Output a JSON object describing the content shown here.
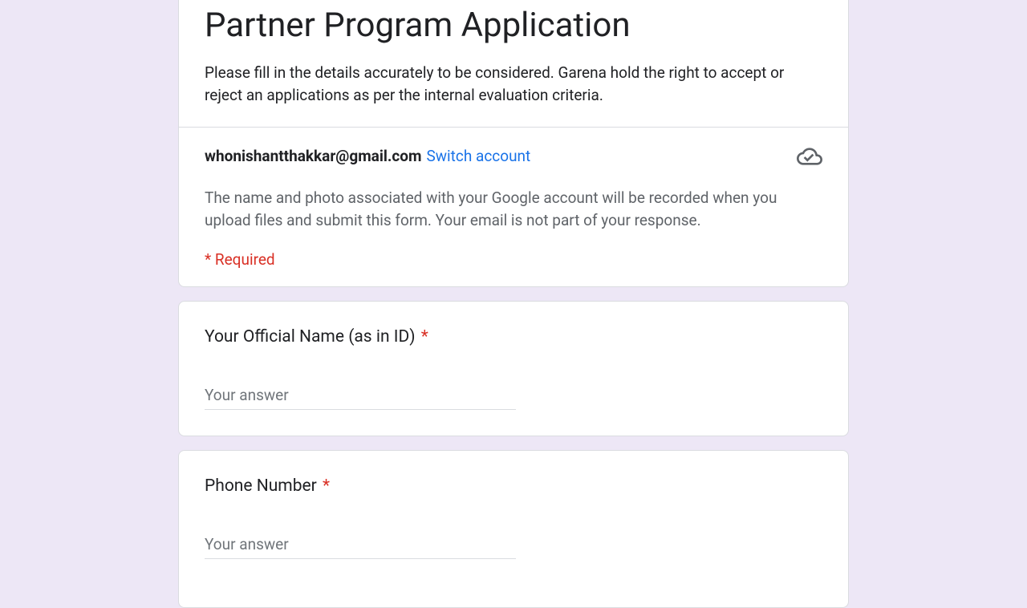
{
  "header": {
    "title": "Partner Program Application",
    "description": "Please fill in the details accurately to be considered. Garena hold the right to accept or reject an applications as per the internal evaluation criteria."
  },
  "account": {
    "email": "whonishantthakkar@gmail.com",
    "switch_label": "Switch account",
    "disclosure": "The name and photo associated with your Google account will be recorded when you upload files and submit this form. Your email is not part of your response.",
    "required_legend": "* Required"
  },
  "questions": [
    {
      "label": "Your Official Name (as in ID)",
      "required": "*",
      "placeholder": "Your answer"
    },
    {
      "label": "Phone Number",
      "required": "*",
      "placeholder": "Your answer"
    }
  ]
}
